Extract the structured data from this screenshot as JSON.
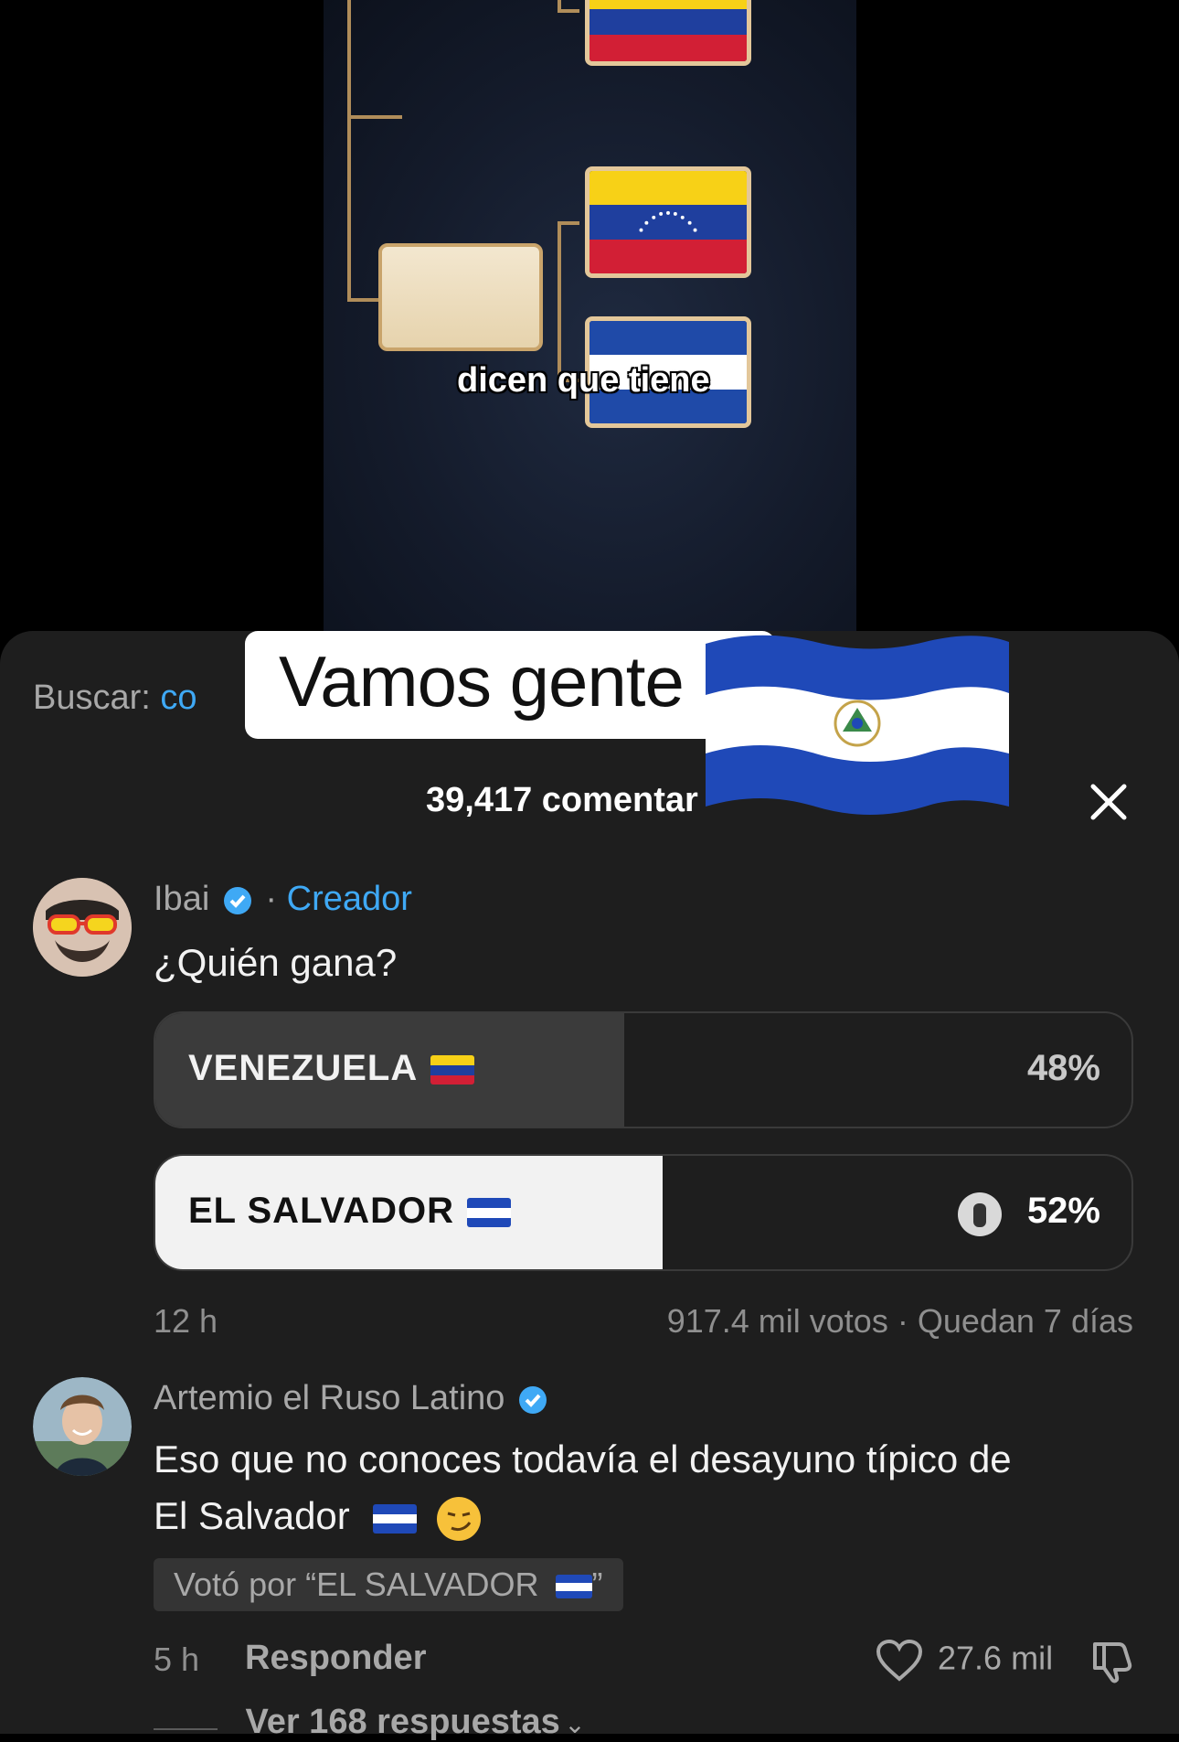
{
  "video": {
    "caption": "dicen que tiene"
  },
  "search": {
    "label": "Buscar:",
    "query_visible": "co"
  },
  "sticker": {
    "text": "Vamos gente"
  },
  "comments_count": "39,417 comentar",
  "poll_comment": {
    "author": "Ibai",
    "separator": "·",
    "role": "Creador",
    "question": "¿Quién gana?",
    "options": [
      {
        "label": "VENEZUELA",
        "percent": "48%",
        "fraction": 0.48
      },
      {
        "label": "EL SALVADOR",
        "percent": "52%",
        "fraction": 0.52
      }
    ],
    "time": "12 h",
    "votes_info": "917.4 mil votos · Quedan 7 días"
  },
  "reply_comment": {
    "author": "Artemio el Ruso Latino",
    "text_line1": "Eso que no conoces todavía el desayuno típico de",
    "text_line2": "El Salvador",
    "vote_chip": "Votó por “EL SALVADOR",
    "vote_chip_end": "”",
    "time": "5 h",
    "reply_label": "Responder",
    "likes": "27.6 mil",
    "view_replies": "Ver 168 respuestas"
  },
  "colors": {
    "accent": "#3fa9f5",
    "sheet_bg": "#1e1e1e",
    "venezuela_fill": "#3b3b3b",
    "salvador_fill": "#f2f2f2"
  }
}
